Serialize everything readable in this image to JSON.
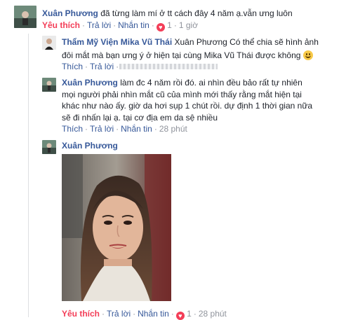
{
  "comments": [
    {
      "author": "Xuân Phương",
      "text": "đã từng làm mí ở tt cách đây 4 năm ạ.vẫn ưng luôn",
      "like_label": "Yêu thích",
      "reply_label": "Trả lời",
      "message_label": "Nhắn tin",
      "reaction_count": "1",
      "time": "1 giờ"
    },
    {
      "author": "Thẩm Mỹ Viện Mika Vũ Thái",
      "text_line1": "Xuân Phương Có thể chia sẽ hình ảnh",
      "text_line2": "đôi mắt mà bạn ưng ý ở hiện tại cùng Mika Vũ Thái được không",
      "like_label": "Thích",
      "reply_label": "Trả lời"
    },
    {
      "author": "Xuân Phương",
      "text_line1": "làm đc 4 năm rồi đó. ai nhìn đều bảo rất tự nhiên",
      "text_line2": "mọi người phải nhìn mắt cũ của mình mới thấy rằng mắt hiện tại",
      "text_line3": "khác như nào ấy. giờ da hơi sụp 1 chút rồi. dự định 1 thời gian nữa",
      "text_line4": "sẽ đi nhấn lại ạ. tại cơ địa em da sệ nhiều",
      "like_label": "Thích",
      "reply_label": "Trả lời",
      "message_label": "Nhắn tin",
      "time": "28 phút"
    },
    {
      "author": "Xuân Phương",
      "like_label": "Yêu thích",
      "reply_label": "Trả lời",
      "message_label": "Nhắn tin",
      "reaction_count": "1",
      "time": "28 phút"
    }
  ],
  "colors": {
    "link": "#365899",
    "text": "#1d2129",
    "meta": "#90949c",
    "love": "#f33e58"
  },
  "icons": [
    "heart-reaction-icon",
    "smile-emoji-icon"
  ]
}
